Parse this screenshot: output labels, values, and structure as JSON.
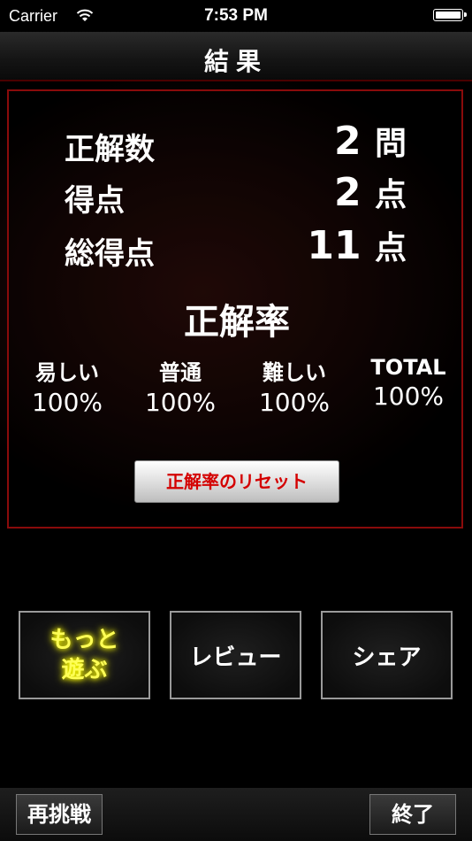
{
  "status_bar": {
    "carrier": "Carrier",
    "time": "7:53 PM"
  },
  "header": {
    "title": "結果"
  },
  "stats": [
    {
      "label": "正解数",
      "value": "2",
      "unit": "問"
    },
    {
      "label": "得点",
      "value": "2",
      "unit": "点"
    },
    {
      "label": "総得点",
      "value": "11",
      "unit": "点"
    }
  ],
  "rates": {
    "title": "正解率",
    "items": [
      {
        "label": "易しい",
        "value": "100%"
      },
      {
        "label": "普通",
        "value": "100%"
      },
      {
        "label": "難しい",
        "value": "100%"
      },
      {
        "label": "TOTAL",
        "value": "100%"
      }
    ],
    "reset_label": "正解率のリセット"
  },
  "actions": {
    "play_more_line1": "もっと",
    "play_more_line2": "遊ぶ",
    "review": "レビュー",
    "share": "シェア"
  },
  "footer": {
    "retry": "再挑戦",
    "finish": "終了"
  },
  "colors": {
    "accent_red": "#d40000",
    "panel_border": "#8a0b0b",
    "glow_yellow": "#ffff55"
  },
  "icons": [
    "wifi-icon",
    "battery-icon"
  ]
}
